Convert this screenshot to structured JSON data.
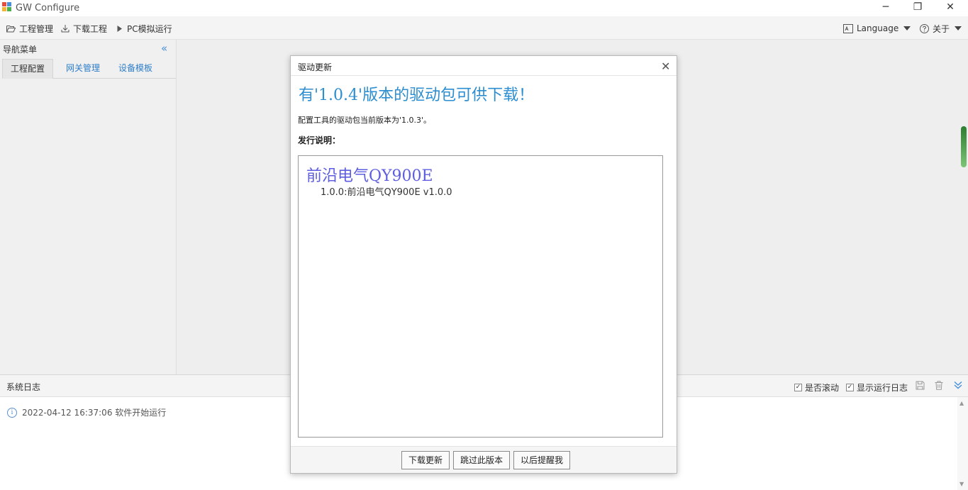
{
  "window": {
    "title": "GW Configure",
    "minimize_glyph": "─",
    "restore_glyph": "❐",
    "close_glyph": "✕"
  },
  "toolbar": {
    "project_manage": "工程管理",
    "download_project": "下载工程",
    "pc_simulate": "PC模拟运行",
    "language": "Language",
    "about": "关于"
  },
  "sidebar": {
    "header": "导航菜单",
    "collapse_glyph": "«",
    "tabs": [
      "工程配置",
      "网关管理",
      "设备模板"
    ]
  },
  "log": {
    "title": "系统日志",
    "auto_scroll": "是否滚动",
    "show_run_log": "显示运行日志",
    "check_glyph": "✓",
    "entry": "2022-04-12 16:37:06 软件开始运行",
    "info_glyph": "i"
  },
  "dialog": {
    "title": "驱动更新",
    "close_glyph": "✕",
    "heading": "有'1.0.4'版本的驱动包可供下载！",
    "current_version": "配置工具的驱动包当前版本为'1.0.3'。",
    "notes_label": "发行说明：",
    "notes_title": "前沿电气QY900E",
    "notes_line": "1.0.0:前沿电气QY900E v1.0.0",
    "buttons": {
      "download": "下载更新",
      "skip": "跳过此版本",
      "remind": "以后提醒我"
    }
  },
  "colors": {
    "accent": "#2c8dd0",
    "notes_title": "#5d5de0",
    "link_tab": "#2f7ec9",
    "scroll_grip": "#2e7d32"
  }
}
